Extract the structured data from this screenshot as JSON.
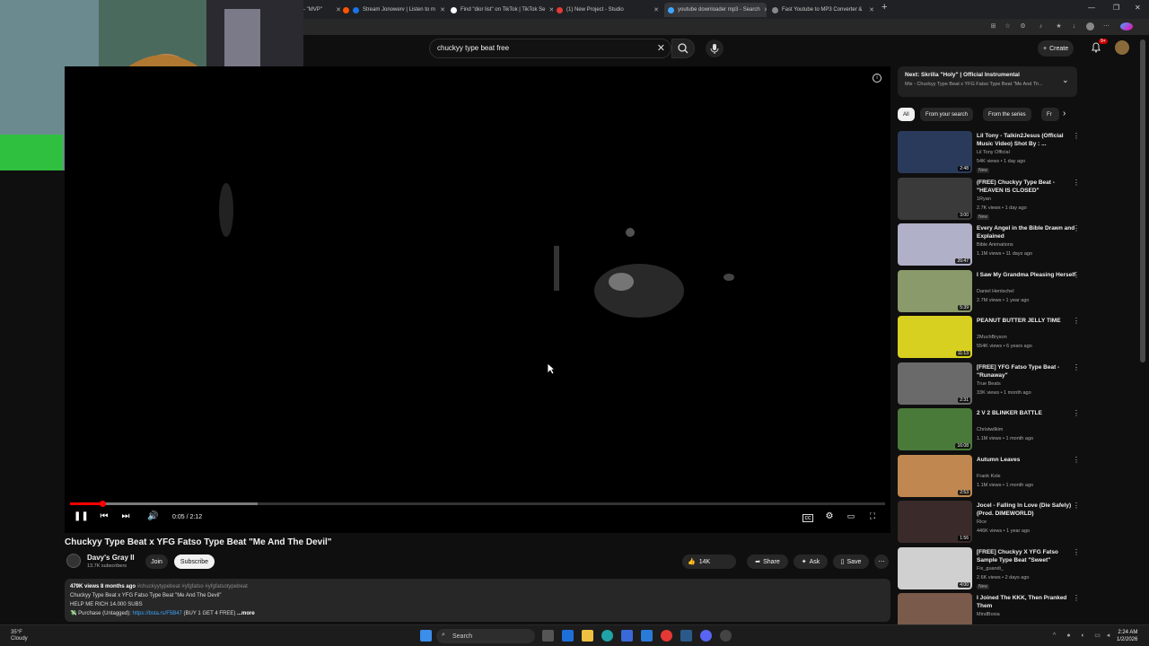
{
  "browser": {
    "tabs": [
      {
        "label": "- \"MVP\"",
        "color": "#888888"
      },
      {
        "label": "Stream Jonowerv | Listen to m",
        "color": "#ff5500"
      },
      {
        "label": "Find \"dior list\" on TikTok | TikTok Se",
        "color": "#ffffff"
      },
      {
        "label": "(1) New Project - Studio",
        "color": "#e53935"
      },
      {
        "label": "youtube downloader mp3 - Search",
        "color": "#3ea6ff"
      },
      {
        "label": "Fast Youtube to MP3 Converter &",
        "color": "#888888"
      }
    ],
    "new_tab": "+"
  },
  "youtube": {
    "search": {
      "value": "chuckyy type beat free",
      "placeholder": "Search"
    },
    "create_label": "Create",
    "notif_count": "9+"
  },
  "player": {
    "time": "0:05 / 2:12",
    "progress_played": 0.04,
    "progress_buffered": 0.23
  },
  "video": {
    "title": "Chuckyy Type Beat x YFG Fatso Type Beat \"Me And The Devil\"",
    "channel": "Davy's Gray II",
    "subs": "13.7K subscribers",
    "join": "Join",
    "subscribe": "Subscribe",
    "likes": "14K",
    "share": "Share",
    "ask": "Ask",
    "save": "Save"
  },
  "description": {
    "stats": "479K views  8 months ago",
    "tags": "#chuckyytypebeat #yfgfatso #yfgfatsotypebeat",
    "line2": "Chuckyy Type Beat x YFG Fatso Type Beat \"Me And The Devil\"",
    "line3": "HELP ME RICH 14.000 SUBS",
    "line4_prefix": "💸 Purchase (Untagged): ",
    "line4_link": "https://bsta.rs/F5B47",
    "line4_suffix": " (BUY 1 GET 4 FREE)",
    "more": "...more"
  },
  "upnext": {
    "title": "Next: Skrilla \"Holy\" | Official Instrumental",
    "subtitle": "Mix - Chuckyy Type Beat x YFG Fatso Type Beat \"Me And Th..."
  },
  "chips": [
    "All",
    "From your search",
    "From the series",
    "Fr"
  ],
  "recommendations": [
    {
      "title": "Lil Tony - Talkin2Jesus (Official Music Video) Shot By : ...",
      "channel": "Lil Tony Official",
      "meta": "54K views • 1 day ago",
      "badge": "New",
      "duration": "2:48",
      "thumb": "#2a3a5a"
    },
    {
      "title": "(FREE) Chuckyy Type Beat - \"HEAVEN IS CLOSED\"",
      "channel": "1Ryan",
      "meta": "2.7K views • 1 day ago",
      "badge": "New",
      "duration": "3:00",
      "thumb": "#3a3a3a"
    },
    {
      "title": "Every Angel in the Bible Drawn and Explained",
      "channel": "Bible Animations",
      "meta": "1.1M views • 11 days ago",
      "badge": "",
      "duration": "26:47",
      "thumb": "#b0b0c8"
    },
    {
      "title": "I Saw My Grandma Pleasing Herself",
      "channel": "Daniel Hentschel",
      "meta": "2.7M views • 1 year ago",
      "badge": "",
      "duration": "5:39",
      "thumb": "#8a9a6a"
    },
    {
      "title": "PEANUT BUTTER JELLY TIME",
      "channel": "2MuchBryson",
      "meta": "554K views • 6 years ago",
      "badge": "",
      "duration": "11:13",
      "thumb": "#d8d020"
    },
    {
      "title": "[FREE] YFG Fatso Type Beat - \"Runaway\"",
      "channel": "True Beats",
      "meta": "33K views • 1 month ago",
      "badge": "",
      "duration": "2:31",
      "thumb": "#6a6a6a"
    },
    {
      "title": "2 V 2 BLINKER BATTLE",
      "channel": "Christwilkim",
      "meta": "1.1M views • 1 month ago",
      "badge": "",
      "duration": "16:08",
      "thumb": "#4a7a3a"
    },
    {
      "title": "Autumn Leaves",
      "channel": "Frank Kole",
      "meta": "1.1M views • 1 month ago",
      "badge": "",
      "duration": "2:53",
      "thumb": "#c08850"
    },
    {
      "title": "Jocel - Falling In Love (Die Safely) (Prod. DIMEWORLD)",
      "channel": "Rice",
      "meta": "446K views • 1 year ago",
      "badge": "",
      "duration": "1:56",
      "thumb": "#3a2a2a"
    },
    {
      "title": "[FREE] Chuckyy X YFG Fatso Sample Type Beat \"Sweet\"",
      "channel": "Fix_guandi_",
      "meta": "2.6K views • 2 days ago",
      "badge": "New",
      "duration": "4:00",
      "thumb": "#d0d0d0"
    },
    {
      "title": "I Joined The KKK, Then Pranked Them",
      "channel": "MindBoxia",
      "meta": "",
      "badge": "",
      "duration": "",
      "thumb": "#7a5a4a"
    }
  ],
  "taskbar": {
    "weather_temp": "35°F",
    "weather_desc": "Cloudy",
    "search_label": "Search",
    "time": "2:24 AM",
    "date": "1/2/2026"
  },
  "colors": {
    "accent": "#ff0000",
    "link": "#3ea6ff",
    "background": "#0f0f0f"
  }
}
